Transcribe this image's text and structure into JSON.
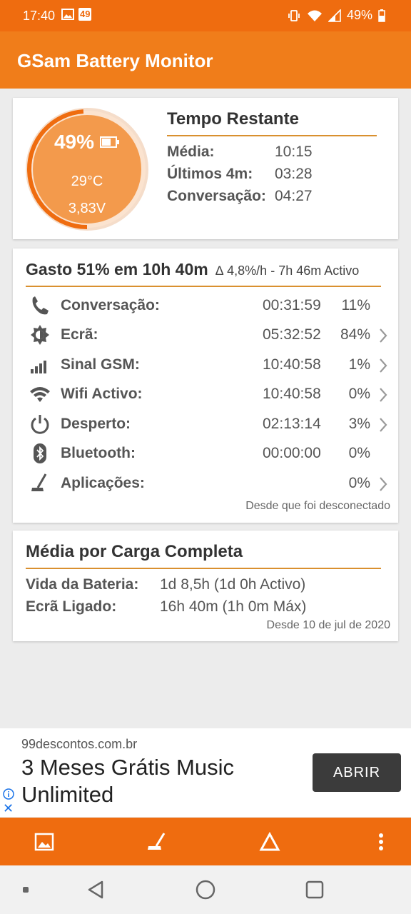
{
  "status_bar": {
    "time": "17:40",
    "badge": "49",
    "battery_text": "49%"
  },
  "app": {
    "title": "GSam Battery Monitor"
  },
  "battery_gauge": {
    "percent": "49%",
    "level": 0.49,
    "temperature": "29°C",
    "voltage": "3,83V"
  },
  "time_remaining": {
    "title": "Tempo Restante",
    "rows": [
      {
        "label": "Média:",
        "value": "10:15"
      },
      {
        "label": "Últimos 4m:",
        "value": "03:28"
      },
      {
        "label": "Conversação:",
        "value": "04:27"
      }
    ]
  },
  "usage": {
    "title": "Gasto 51% em 10h 40m",
    "subtitle": "∆ 4,8%/h - 7h 46m Activo",
    "rows": [
      {
        "icon": "phone-icon",
        "label": "Conversação:",
        "time": "00:31:59",
        "percent": "11%",
        "chevron": false
      },
      {
        "icon": "brightness-icon",
        "label": "Ecrã:",
        "time": "05:32:52",
        "percent": "84%",
        "chevron": true
      },
      {
        "icon": "signal-icon",
        "label": "Sinal GSM:",
        "time": "10:40:58",
        "percent": "1%",
        "chevron": true
      },
      {
        "icon": "wifi-icon",
        "label": "Wifi Activo:",
        "time": "10:40:58",
        "percent": "0%",
        "chevron": true
      },
      {
        "icon": "power-icon",
        "label": "Desperto:",
        "time": "02:13:14",
        "percent": "3%",
        "chevron": true
      },
      {
        "icon": "bluetooth-icon",
        "label": "Bluetooth:",
        "time": "00:00:00",
        "percent": "0%",
        "chevron": false
      },
      {
        "icon": "apps-icon",
        "label": "Aplicações:",
        "time": "",
        "percent": "0%",
        "chevron": true
      }
    ],
    "footer": "Desde que foi desconectado"
  },
  "full_charge": {
    "title": "Média por Carga Completa",
    "rows": [
      {
        "label": "Vida da Bateria:",
        "value": "1d 8,5h (1d 0h Activo)"
      },
      {
        "label": "Ecrã Ligado:",
        "value": "16h 40m (1h 0m Máx)"
      }
    ],
    "footer": "Desde 10 de jul de 2020"
  },
  "ad": {
    "domain": "99descontos.com.br",
    "headline": "3 Meses Grátis Music Unlimited",
    "button": "ABRIR",
    "close": "✕"
  },
  "colors": {
    "status_bar": "#ef6c0f",
    "app_bar": "#f07d1a",
    "accent_line": "#d9902f",
    "gauge_fill": "#f39a4c",
    "gauge_ring": "#ef6c0f"
  }
}
